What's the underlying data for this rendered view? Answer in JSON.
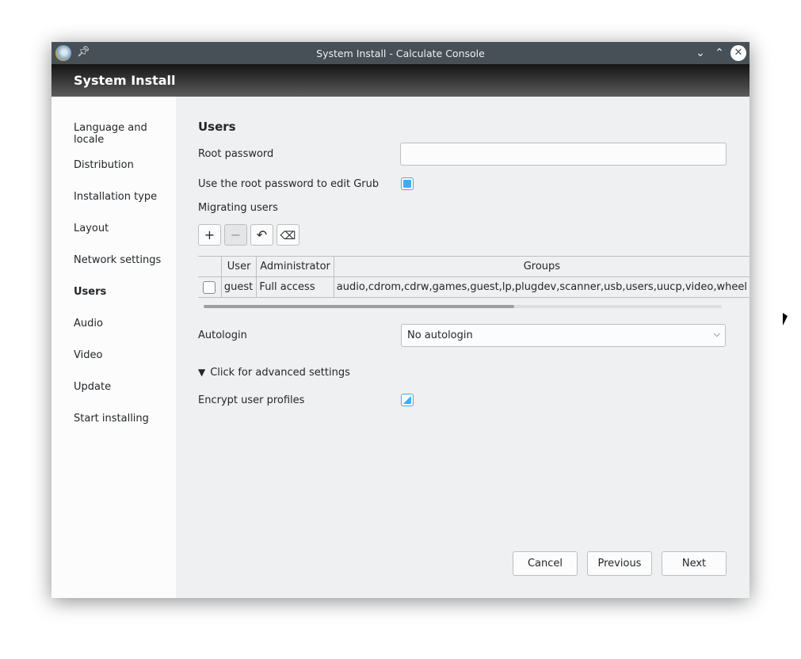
{
  "window": {
    "title": "System Install - Calculate Console",
    "header": "System Install"
  },
  "sidebar": {
    "items": [
      {
        "label": "Language and locale"
      },
      {
        "label": "Distribution"
      },
      {
        "label": "Installation type"
      },
      {
        "label": "Layout"
      },
      {
        "label": "Network settings"
      },
      {
        "label": "Users",
        "active": true
      },
      {
        "label": "Audio"
      },
      {
        "label": "Video"
      },
      {
        "label": "Update"
      },
      {
        "label": "Start installing"
      }
    ]
  },
  "main": {
    "title": "Users",
    "root_password_label": "Root password",
    "root_password_value": "",
    "grub_label": "Use the root password to edit Grub",
    "grub_checked": true,
    "migrating_label": "Migrating users",
    "table": {
      "headers": [
        "",
        "User",
        "Administrator",
        "Groups"
      ],
      "rows": [
        {
          "checked": false,
          "user": "guest",
          "admin": "Full access",
          "groups": "audio,cdrom,cdrw,games,guest,lp,plugdev,scanner,usb,users,uucp,video,wheel"
        }
      ]
    },
    "autologin_label": "Autologin",
    "autologin_value": "No autologin",
    "advanced_label": "Click for advanced settings",
    "encrypt_label": "Encrypt user profiles",
    "encrypt_state": "partial"
  },
  "buttons": {
    "cancel": "Cancel",
    "previous": "Previous",
    "next": "Next"
  },
  "accent": "#3daee9"
}
